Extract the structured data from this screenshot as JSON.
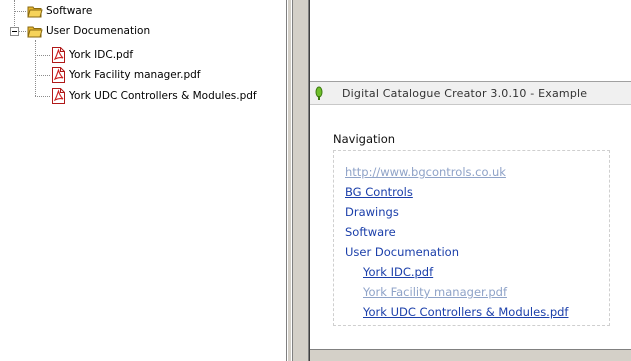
{
  "tree": {
    "items": [
      {
        "label": "Software"
      },
      {
        "label": "User Documenation"
      },
      {
        "label": "York IDC.pdf"
      },
      {
        "label": "York Facility manager.pdf"
      },
      {
        "label": "York UDC Controllers & Modules.pdf"
      }
    ]
  },
  "window": {
    "title": "Digital Catalogue Creator  3.0.10  -  Example"
  },
  "navigation": {
    "heading": "Navigation",
    "links": [
      {
        "label": "http://www.bgcontrols.co.uk"
      },
      {
        "label": "BG Controls"
      },
      {
        "label": "Drawings"
      },
      {
        "label": "Software"
      },
      {
        "label": "User Documenation"
      },
      {
        "label": "York IDC.pdf"
      },
      {
        "label": "York Facility manager.pdf"
      },
      {
        "label": "York UDC Controllers & Modules.pdf"
      }
    ]
  },
  "colors": {
    "link": "#1b3faa",
    "visited_link": "#8fa3c8",
    "pdf_icon": "#cc1f1f",
    "folder_icon": "#e8b832"
  }
}
